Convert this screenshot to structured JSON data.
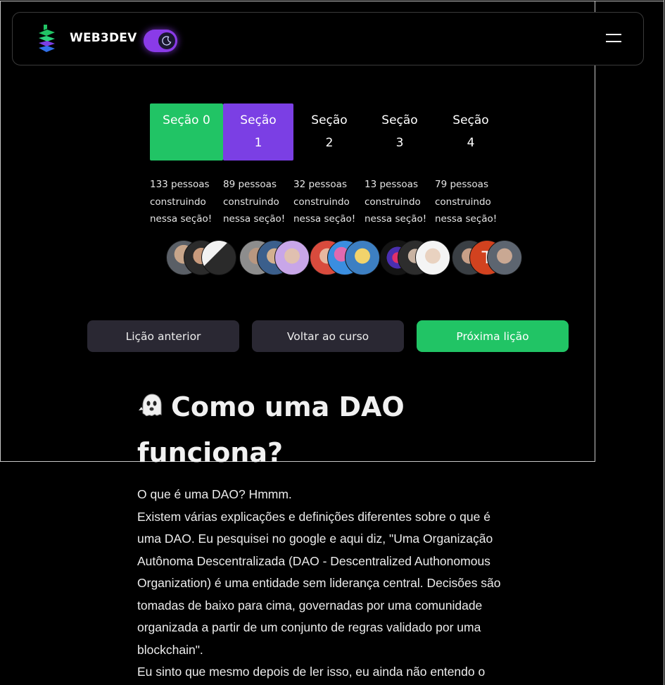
{
  "navbar": {
    "brand": "WEB3DEV",
    "logo_icon": "web3dev-logo-icon",
    "theme_toggle_icon": "moon-icon",
    "menu_icon": "hamburger-menu-icon",
    "colors": {
      "toggle": "#8a3be8",
      "logo_green": "#21c465",
      "logo_purple": "#7b3fe4",
      "logo_blue": "#2f6fe8"
    }
  },
  "sections": [
    {
      "label_line1": "Seção 0",
      "label_line2": "",
      "count": "133 pessoas construindo nessa seção!",
      "state": "completed"
    },
    {
      "label_line1": "Seção",
      "label_line2": "1",
      "count": "89 pessoas construindo nessa seção!",
      "state": "current"
    },
    {
      "label_line1": "Seção",
      "label_line2": "2",
      "count": "32 pessoas construindo nessa seção!",
      "state": "locked"
    },
    {
      "label_line1": "Seção",
      "label_line2": "3",
      "count": "13 pessoas construindo nessa seção!",
      "state": "locked"
    },
    {
      "label_line1": "Seção",
      "label_line2": "4",
      "count": "79 pessoas construindo nessa seção!",
      "state": "locked"
    }
  ],
  "section_colors": {
    "completed": "#21c465",
    "current": "#7b3fe4"
  },
  "buttons": {
    "prev": "Lição anterior",
    "back": "Voltar ao curso",
    "next": "Próxima lição"
  },
  "lesson": {
    "title_icon": "ghost-icon",
    "title": "Como uma DAO funciona?",
    "paragraphs": [
      "O que é uma DAO? Hmmm.",
      "Existem várias explicações e definições diferentes sobre o que é uma DAO. Eu pesquisei no google e aqui diz, \"Uma Organização Autônoma Descentralizada (DAO - Descentralized Authonomous Organization) é uma entidade sem liderança central. Decisões são tomadas de baixo para cima, governadas por uma comunidade organizada a partir de um conjunto de regras validado por uma blockchain\".",
      "Eu sinto que mesmo depois de ler isso, eu ainda não entendo o"
    ]
  }
}
